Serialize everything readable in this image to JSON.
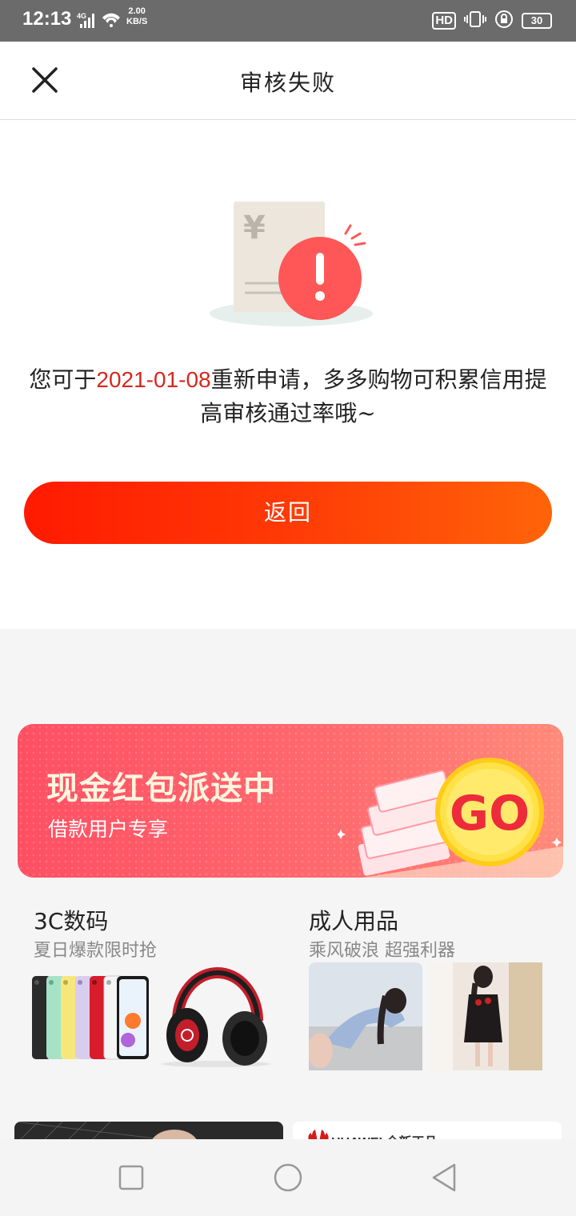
{
  "status_bar": {
    "time": "12:13",
    "network": "4G",
    "speed_value": "2.00",
    "speed_unit": "KB/S",
    "hd": "HD",
    "battery": "30"
  },
  "header": {
    "title": "审核失败"
  },
  "main": {
    "message_prefix": "您可于",
    "message_date": "2021-01-08",
    "message_suffix": "重新申请，多多购物可积累信用提高审核通过率哦~",
    "back_button": "返回"
  },
  "banner": {
    "title": "现金红包派送中",
    "subtitle": "借款用户专享",
    "go_label": "GO"
  },
  "categories": [
    {
      "title": "3C数码",
      "subtitle": "夏日爆款限时抢"
    },
    {
      "title": "成人用品",
      "subtitle": "乘风破浪 超强利器"
    }
  ],
  "bottom_row": {
    "right_brand": "HUAWEI 全新正品"
  },
  "colors": {
    "accent_red": "#ff1a00",
    "accent_orange": "#ff6408",
    "date_red": "#d6281e",
    "banner_red": "#ff4f63"
  }
}
